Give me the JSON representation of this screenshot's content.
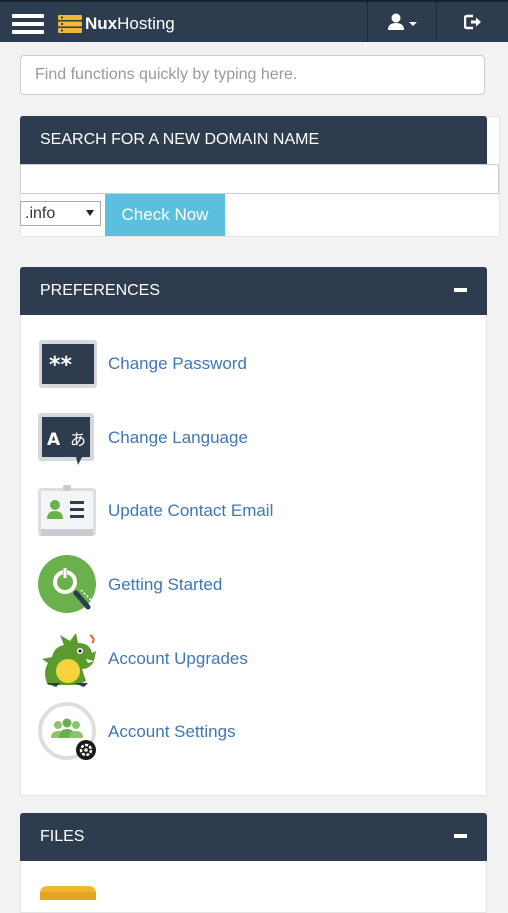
{
  "header": {
    "brand_bold": "Nux",
    "brand_rest": "Hosting"
  },
  "search": {
    "placeholder": "Find functions quickly by typing here.",
    "value": ""
  },
  "domain": {
    "title": "SEARCH FOR A NEW DOMAIN NAME",
    "input_value": "",
    "tld_selected": ".info",
    "check_label": "Check Now"
  },
  "preferences": {
    "title": "PREFERENCES",
    "items": [
      {
        "label": "Change Password",
        "icon": "password-icon"
      },
      {
        "label": "Change Language",
        "icon": "language-icon"
      },
      {
        "label": "Update Contact Email",
        "icon": "contact-card-icon"
      },
      {
        "label": "Getting Started",
        "icon": "getting-started-icon"
      },
      {
        "label": "Account Upgrades",
        "icon": "dragon-icon"
      },
      {
        "label": "Account Settings",
        "icon": "account-settings-icon"
      }
    ]
  },
  "files": {
    "title": "FILES"
  },
  "colors": {
    "header_bg": "#2e3c4f",
    "accent_button": "#5bc0de",
    "link": "#3d77b8"
  }
}
